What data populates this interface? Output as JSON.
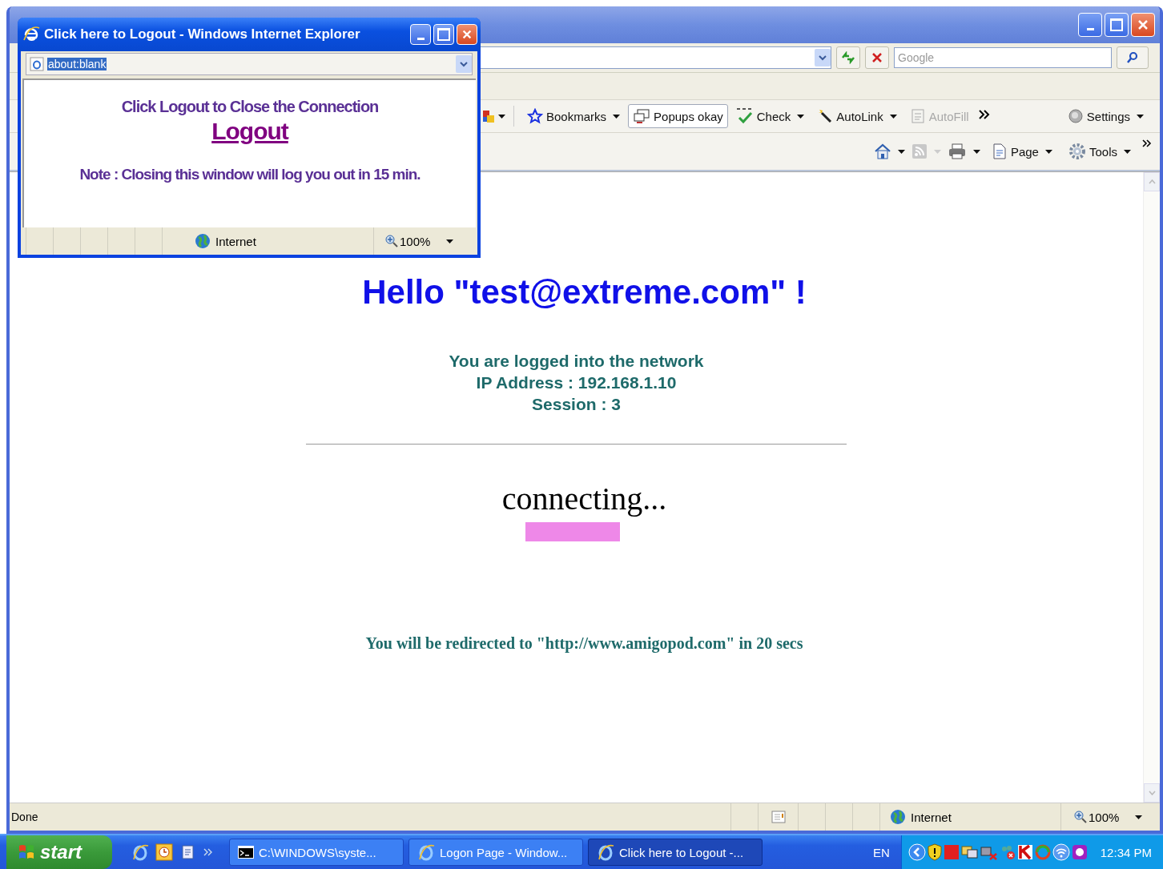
{
  "main_window": {
    "search": {
      "placeholder": "Google"
    },
    "toolbar": [
      {
        "label": "Bookmarks",
        "dropdown": true,
        "pressed": false,
        "disabled": false
      },
      {
        "label": "Popups okay",
        "dropdown": false,
        "pressed": true,
        "disabled": false
      },
      {
        "label": "Check",
        "dropdown": true,
        "pressed": false,
        "disabled": false
      },
      {
        "label": "AutoLink",
        "dropdown": true,
        "pressed": false,
        "disabled": false
      },
      {
        "label": "AutoFill",
        "dropdown": false,
        "pressed": false,
        "disabled": true
      }
    ],
    "settings": "Settings",
    "command_bar": [
      {
        "label": "Page"
      },
      {
        "label": "Tools"
      }
    ],
    "page": {
      "heading": "Hello \"test@extreme.com\" !",
      "lines": [
        "You are logged into the network",
        "IP Address : 192.168.1.10",
        "Session : 3"
      ],
      "status": "connecting...",
      "redirect": "You will be redirected to \"http://www.amigopod.com\" in 20 secs"
    },
    "status_bar": {
      "text": "Done",
      "zone": "Internet",
      "zoom": "100%"
    }
  },
  "popup": {
    "title": "Click here to Logout - Windows Internet Explorer",
    "address": "about:blank",
    "prompt": "Click Logout to Close the Connection",
    "link": "Logout",
    "note": "Note : Closing this window will log you out in 15 min.",
    "status_bar": {
      "zone": "Internet",
      "zoom": "100%"
    }
  },
  "taskbar": {
    "start": "start",
    "tasks": [
      {
        "label": "C:\\WINDOWS\\syste...",
        "kind": "console",
        "selected": false
      },
      {
        "label": "Logon Page - Window...",
        "kind": "browser",
        "selected": false
      },
      {
        "label": "Click here to Logout -...",
        "kind": "browser",
        "selected": true
      }
    ],
    "language": "EN",
    "clock": "12:34 PM"
  }
}
